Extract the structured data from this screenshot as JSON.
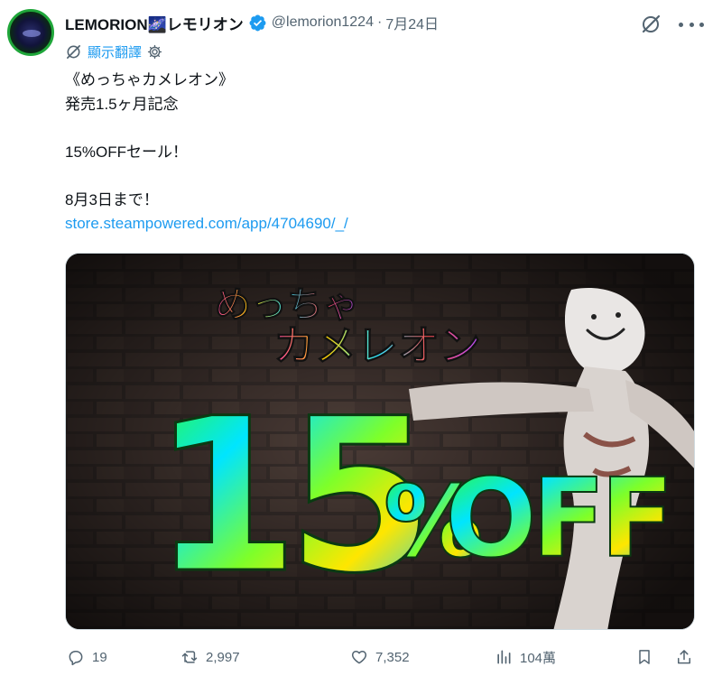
{
  "author": {
    "display_name": "LEMORION🌌レモリオン",
    "handle": "@lemorion1224",
    "separator": "·",
    "date": "7月24日",
    "avatar": "avatar-image"
  },
  "translate": {
    "icon": "translate-icon",
    "label": "顯示翻譯",
    "settings_icon": "gear-icon"
  },
  "tweet": {
    "lines": [
      "《めっちゃカメレオン》",
      "発売1.5ヶ月記念",
      "",
      "15%OFFセール！",
      "",
      "8月3日まで！"
    ],
    "link": "store.steampowered.com/app/4704690/_/"
  },
  "media": {
    "game_title_line1": "めっちゃ",
    "game_title_line2": "カメレオン",
    "promo_number": "15",
    "promo_percent": "%",
    "promo_off": "OFF"
  },
  "actions": {
    "replies": "19",
    "reposts": "2,997",
    "likes": "7,352",
    "views": "104萬"
  },
  "colors": {
    "link": "#1d9bf0",
    "muted": "#536471",
    "verified": "#1d9bf0",
    "text": "#0f1419"
  },
  "icons": [
    "grok-icon",
    "more-icon",
    "reply-icon",
    "repost-icon",
    "like-icon",
    "views-icon",
    "bookmark-icon",
    "share-icon"
  ]
}
